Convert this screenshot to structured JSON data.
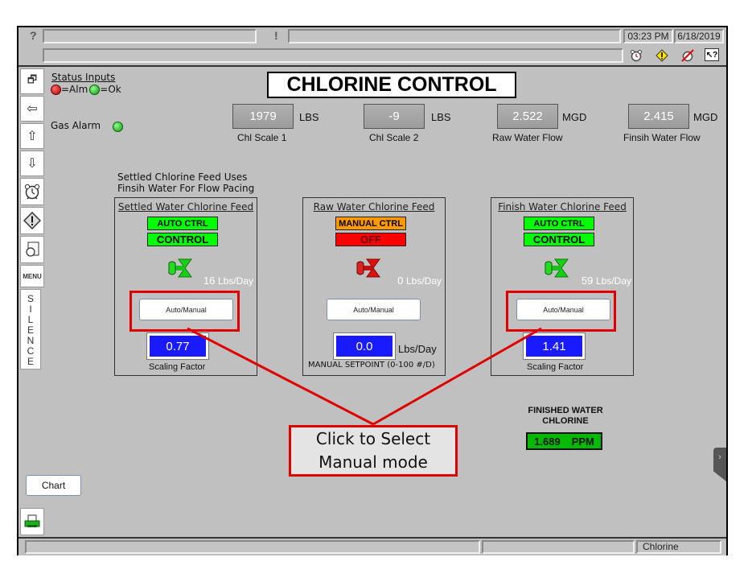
{
  "topbar": {
    "help_glyph": "?",
    "alert_glyph": "!",
    "time": "03:23 PM",
    "date": "6/18/2019",
    "icons": [
      "alarm-clock-icon",
      "warning-diamond-icon",
      "silenced-alarm-icon",
      "context-help-icon"
    ]
  },
  "left_toolbar": {
    "items": [
      {
        "name": "windows-icon",
        "glyph": "🗗"
      },
      {
        "name": "back-icon",
        "glyph": "⇦"
      },
      {
        "name": "up-arrow-icon",
        "glyph": "⇧"
      },
      {
        "name": "down-arrow-icon",
        "glyph": "⇩"
      },
      {
        "name": "alarm-clock-icon",
        "glyph": "⏰"
      },
      {
        "name": "warning-icon",
        "glyph": "◈"
      },
      {
        "name": "alarm-log-icon",
        "glyph": "✎"
      }
    ],
    "menu_label": "MENU",
    "silence_label": "SILENCE"
  },
  "header": {
    "title": "CHLORINE CONTROL"
  },
  "status_inputs": {
    "title": "Status Inputs",
    "legend_alarm": "=Alm",
    "legend_ok": "=Ok",
    "gas_alarm_label": "Gas Alarm",
    "gas_alarm_state": "ok",
    "colors": {
      "alarm": "#cc0000",
      "ok": "#22bb22"
    }
  },
  "readouts": [
    {
      "value": "1979",
      "unit": "LBS",
      "label": "Chl Scale 1"
    },
    {
      "value": "-9",
      "unit": "LBS",
      "label": "Chl Scale 2"
    },
    {
      "value": "2.522",
      "unit": "MGD",
      "label": "Raw Water Flow"
    },
    {
      "value": "2.415",
      "unit": "MGD",
      "label": "Finsih Water Flow"
    }
  ],
  "note": {
    "line1": "Settled Chlorine Feed Uses",
    "line2": "Finsih Water For Flow Pacing"
  },
  "panels": [
    {
      "title": "Settled Water Chlorine Feed",
      "mode": "AUTO CTRL",
      "state": "CONTROL",
      "rate_value": "16",
      "rate_unit": "Lbs/Day",
      "button": "Auto/Manual",
      "value": "0.77",
      "value_label": "Scaling Factor",
      "value_unit": ""
    },
    {
      "title": "Raw Water Chlorine Feed",
      "mode": "MANUAL CTRL",
      "state": "OFF",
      "rate_value": "0",
      "rate_unit": "Lbs/Day",
      "button": "Auto/Manual",
      "value": "0.0",
      "value_label": "MANUAL SETPOINT (0-100 #/D)",
      "value_unit": "Lbs/Day"
    },
    {
      "title": "Finish Water Chlorine Feed",
      "mode": "AUTO CTRL",
      "state": "CONTROL",
      "rate_value": "59",
      "rate_unit": "Lbs/Day",
      "button": "Auto/Manual",
      "value": "1.41",
      "value_label": "Scaling Factor",
      "value_unit": ""
    }
  ],
  "finished_chlorine": {
    "label_line1": "FINISHED WATER",
    "label_line2": "CHLORINE",
    "value": "1.689",
    "unit": "PPM"
  },
  "annotation": {
    "line1": "Click to Select",
    "line2": "Manual mode"
  },
  "chart_button": "Chart",
  "footer": {
    "screen_name": "Chlorine"
  },
  "colors": {
    "auto_green": "#00ff00",
    "manual_orange": "#ff9900",
    "off_red": "#ff0000",
    "setpoint_blue": "#1a1aff",
    "ppm_green": "#00bb00",
    "annotation_red": "#e00000"
  }
}
